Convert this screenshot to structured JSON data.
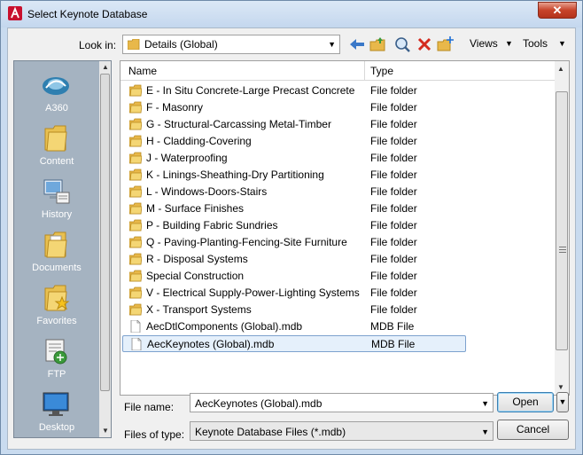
{
  "window": {
    "title": "Select Keynote Database",
    "close_label": "✕"
  },
  "toolbar": {
    "lookin_label": "Look in:",
    "lookin_value": "Details (Global)",
    "views_label": "Views",
    "tools_label": "Tools"
  },
  "places": [
    {
      "label": "A360",
      "icon": "a360-icon"
    },
    {
      "label": "Content",
      "icon": "folder-icon"
    },
    {
      "label": "History",
      "icon": "history-icon"
    },
    {
      "label": "Documents",
      "icon": "documents-icon"
    },
    {
      "label": "Favorites",
      "icon": "favorites-icon"
    },
    {
      "label": "FTP",
      "icon": "ftp-icon"
    },
    {
      "label": "Desktop",
      "icon": "desktop-icon"
    }
  ],
  "filelist": {
    "columns": [
      "Name",
      "Type"
    ],
    "rows": [
      {
        "name": "E - In Situ Concrete-Large Precast Concrete",
        "type": "File folder",
        "kind": "folder"
      },
      {
        "name": "F - Masonry",
        "type": "File folder",
        "kind": "folder"
      },
      {
        "name": "G - Structural-Carcassing Metal-Timber",
        "type": "File folder",
        "kind": "folder"
      },
      {
        "name": "H - Cladding-Covering",
        "type": "File folder",
        "kind": "folder"
      },
      {
        "name": "J - Waterproofing",
        "type": "File folder",
        "kind": "folder"
      },
      {
        "name": "K - Linings-Sheathing-Dry Partitioning",
        "type": "File folder",
        "kind": "folder"
      },
      {
        "name": "L - Windows-Doors-Stairs",
        "type": "File folder",
        "kind": "folder"
      },
      {
        "name": "M - Surface Finishes",
        "type": "File folder",
        "kind": "folder"
      },
      {
        "name": "P - Building Fabric Sundries",
        "type": "File folder",
        "kind": "folder"
      },
      {
        "name": "Q - Paving-Planting-Fencing-Site Furniture",
        "type": "File folder",
        "kind": "folder"
      },
      {
        "name": "R - Disposal Systems",
        "type": "File folder",
        "kind": "folder"
      },
      {
        "name": "Special Construction",
        "type": "File folder",
        "kind": "folder"
      },
      {
        "name": "V - Electrical Supply-Power-Lighting Systems",
        "type": "File folder",
        "kind": "folder"
      },
      {
        "name": "X - Transport Systems",
        "type": "File folder",
        "kind": "folder"
      },
      {
        "name": "AecDtlComponents (Global).mdb",
        "type": "MDB File",
        "kind": "file"
      },
      {
        "name": "AecKeynotes (Global).mdb",
        "type": "MDB File",
        "kind": "file",
        "selected": true
      }
    ]
  },
  "footer": {
    "filename_label": "File name:",
    "filename_value": "AecKeynotes (Global).mdb",
    "filetype_label": "Files of type:",
    "filetype_value": "Keynote Database Files (*.mdb)",
    "open_label": "Open",
    "cancel_label": "Cancel"
  },
  "colors": {
    "accent": "#3c7fb1",
    "selection": "#e5f0fb",
    "places_bg": "#a5b3c1"
  }
}
